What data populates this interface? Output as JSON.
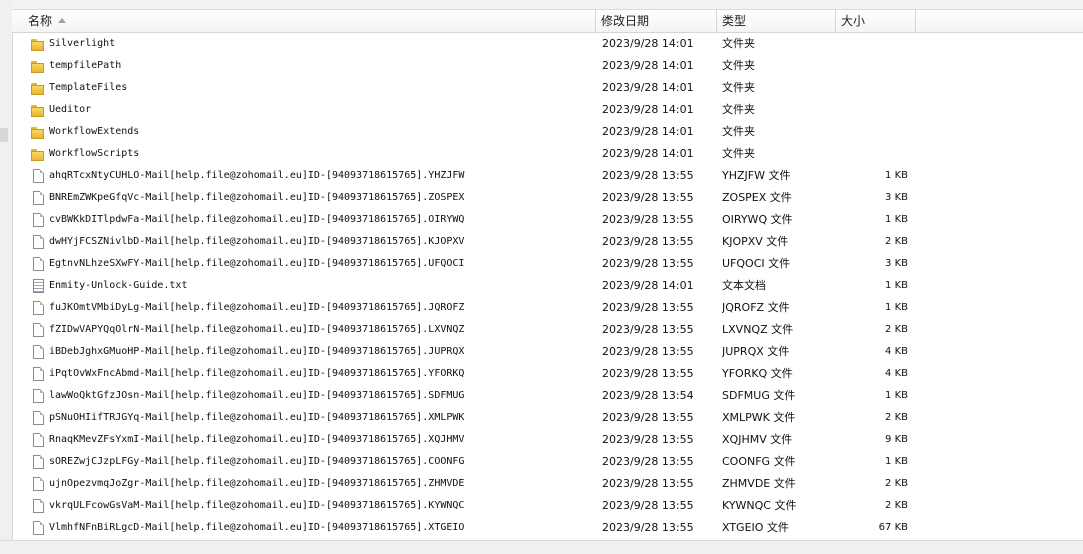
{
  "header": {
    "name": "名称",
    "date": "修改日期",
    "type": "类型",
    "size": "大小"
  },
  "rows": [
    {
      "icon": "folder-icon",
      "name": "Silverlight",
      "date": "2023/9/28 14:01",
      "type": "文件夹",
      "size": ""
    },
    {
      "icon": "folder-icon",
      "name": "tempfilePath",
      "date": "2023/9/28 14:01",
      "type": "文件夹",
      "size": ""
    },
    {
      "icon": "folder-icon",
      "name": "TemplateFiles",
      "date": "2023/9/28 14:01",
      "type": "文件夹",
      "size": ""
    },
    {
      "icon": "folder-icon",
      "name": "Ueditor",
      "date": "2023/9/28 14:01",
      "type": "文件夹",
      "size": ""
    },
    {
      "icon": "folder-icon",
      "name": "WorkflowExtends",
      "date": "2023/9/28 14:01",
      "type": "文件夹",
      "size": ""
    },
    {
      "icon": "folder-icon",
      "name": "WorkflowScripts",
      "date": "2023/9/28 14:01",
      "type": "文件夹",
      "size": ""
    },
    {
      "icon": "file-icon",
      "name": "ahqRTcxNtyCUHLO-Mail[help.file@zohomail.eu]ID-[94093718615765].YHZJFW",
      "date": "2023/9/28 13:55",
      "type": "YHZJFW 文件",
      "size": "1 KB"
    },
    {
      "icon": "file-icon",
      "name": "BNREmZWKpeGfqVc-Mail[help.file@zohomail.eu]ID-[94093718615765].ZOSPEX",
      "date": "2023/9/28 13:55",
      "type": "ZOSPEX 文件",
      "size": "3 KB"
    },
    {
      "icon": "file-icon",
      "name": "cvBWKkDITlpdwFa-Mail[help.file@zohomail.eu]ID-[94093718615765].OIRYWQ",
      "date": "2023/9/28 13:55",
      "type": "OIRYWQ 文件",
      "size": "1 KB"
    },
    {
      "icon": "file-icon",
      "name": "dwHYjFCSZNivlbD-Mail[help.file@zohomail.eu]ID-[94093718615765].KJOPXV",
      "date": "2023/9/28 13:55",
      "type": "KJOPXV 文件",
      "size": "2 KB"
    },
    {
      "icon": "file-icon",
      "name": "EgtnvNLhzeSXwFY-Mail[help.file@zohomail.eu]ID-[94093718615765].UFQOCI",
      "date": "2023/9/28 13:55",
      "type": "UFQOCI 文件",
      "size": "3 KB"
    },
    {
      "icon": "text-icon",
      "name": "Enmity-Unlock-Guide.txt",
      "date": "2023/9/28 14:01",
      "type": "文本文档",
      "size": "1 KB"
    },
    {
      "icon": "file-icon",
      "name": "fuJKOmtVMbiDyLg-Mail[help.file@zohomail.eu]ID-[94093718615765].JQROFZ",
      "date": "2023/9/28 13:55",
      "type": "JQROFZ 文件",
      "size": "1 KB"
    },
    {
      "icon": "file-icon",
      "name": "fZIDwVAPYQqOlrN-Mail[help.file@zohomail.eu]ID-[94093718615765].LXVNQZ",
      "date": "2023/9/28 13:55",
      "type": "LXVNQZ 文件",
      "size": "2 KB"
    },
    {
      "icon": "file-icon",
      "name": "iBDebJghxGMuoHP-Mail[help.file@zohomail.eu]ID-[94093718615765].JUPRQX",
      "date": "2023/9/28 13:55",
      "type": "JUPRQX 文件",
      "size": "4 KB"
    },
    {
      "icon": "file-icon",
      "name": "iPqtOvWxFncAbmd-Mail[help.file@zohomail.eu]ID-[94093718615765].YFORKQ",
      "date": "2023/9/28 13:55",
      "type": "YFORKQ 文件",
      "size": "4 KB"
    },
    {
      "icon": "file-icon",
      "name": "lawWoQktGfzJOsn-Mail[help.file@zohomail.eu]ID-[94093718615765].SDFMUG",
      "date": "2023/9/28 13:54",
      "type": "SDFMUG 文件",
      "size": "1 KB"
    },
    {
      "icon": "file-icon",
      "name": "pSNuOHIifTRJGYq-Mail[help.file@zohomail.eu]ID-[94093718615765].XMLPWK",
      "date": "2023/9/28 13:55",
      "type": "XMLPWK 文件",
      "size": "2 KB"
    },
    {
      "icon": "file-icon",
      "name": "RnaqKMevZFsYxmI-Mail[help.file@zohomail.eu]ID-[94093718615765].XQJHMV",
      "date": "2023/9/28 13:55",
      "type": "XQJHMV 文件",
      "size": "9 KB"
    },
    {
      "icon": "file-icon",
      "name": "sOREZwjCJzpLFGy-Mail[help.file@zohomail.eu]ID-[94093718615765].COONFG",
      "date": "2023/9/28 13:55",
      "type": "COONFG 文件",
      "size": "1 KB"
    },
    {
      "icon": "file-icon",
      "name": "ujnOpezvmqJoZgr-Mail[help.file@zohomail.eu]ID-[94093718615765].ZHMVDE",
      "date": "2023/9/28 13:55",
      "type": "ZHMVDE 文件",
      "size": "2 KB"
    },
    {
      "icon": "file-icon",
      "name": "vkrqULFcowGsVaM-Mail[help.file@zohomail.eu]ID-[94093718615765].KYWNQC",
      "date": "2023/9/28 13:55",
      "type": "KYWNQC 文件",
      "size": "2 KB"
    },
    {
      "icon": "file-icon",
      "name": "VlmhfNFnBiRLgcD-Mail[help.file@zohomail.eu]ID-[94093718615765].XTGEIO",
      "date": "2023/9/28 13:55",
      "type": "XTGEIO 文件",
      "size": "67 KB"
    }
  ]
}
